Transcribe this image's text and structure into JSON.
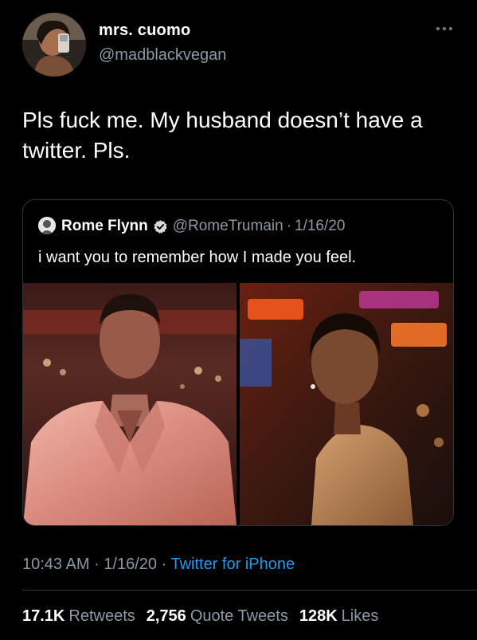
{
  "author": {
    "display_name": "mrs. cuomo",
    "handle": "@madblackvegan",
    "avatar_icon": "profile-photo"
  },
  "tweet": {
    "text": "Pls fuck me. My husband doesn’t have a twitter. Pls."
  },
  "quoted_tweet": {
    "display_name": "Rome Flynn",
    "verified": true,
    "handle": "@RomeTrumain",
    "separator": "·",
    "date": "1/16/20",
    "text": "i want you to remember how I made you feel.",
    "media": [
      "photo-pink-satin-shirt",
      "photo-neon-night"
    ]
  },
  "meta": {
    "time": "10:43 AM",
    "sep1": " · ",
    "date": "1/16/20",
    "sep2": " · ",
    "source": "Twitter for iPhone"
  },
  "stats": {
    "retweets_count": "17.1K",
    "retweets_label": "Retweets",
    "quotes_count": "2,756",
    "quotes_label": "Quote Tweets",
    "likes_count": "128K",
    "likes_label": "Likes"
  },
  "colors": {
    "background": "#000000",
    "secondary_text": "#8b98a5",
    "link": "#1d9bf0",
    "verified": "#d9d9d9",
    "border": "#2f3336"
  }
}
